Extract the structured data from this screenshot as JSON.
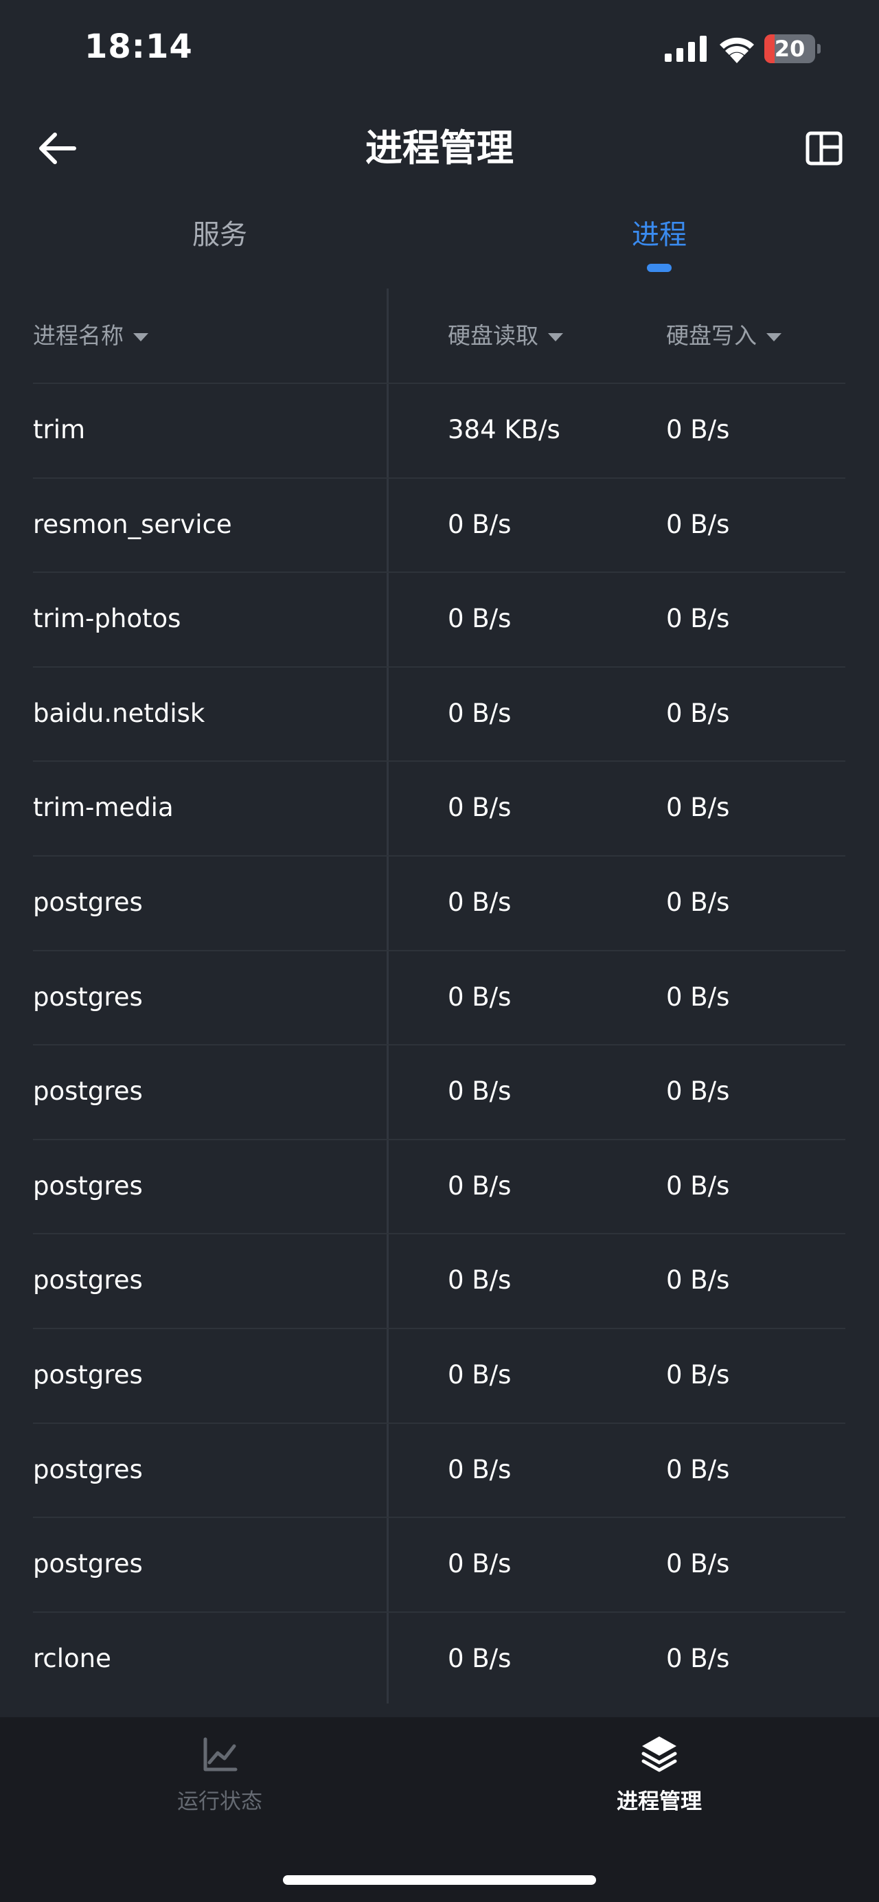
{
  "status_bar": {
    "time": "18:14",
    "battery_level": "20",
    "battery_fraction": 0.2
  },
  "header": {
    "title": "进程管理"
  },
  "tabs": [
    {
      "label": "服务",
      "active": false
    },
    {
      "label": "进程",
      "active": true
    }
  ],
  "table": {
    "columns": [
      {
        "label": "进程名称"
      },
      {
        "label": "硬盘读取"
      },
      {
        "label": "硬盘写入"
      }
    ],
    "rows": [
      {
        "name": "trim",
        "read": "384 KB/s",
        "write": "0 B/s"
      },
      {
        "name": "resmon_service",
        "read": "0 B/s",
        "write": "0 B/s"
      },
      {
        "name": "trim-photos",
        "read": "0 B/s",
        "write": "0 B/s"
      },
      {
        "name": "baidu.netdisk",
        "read": "0 B/s",
        "write": "0 B/s"
      },
      {
        "name": "trim-media",
        "read": "0 B/s",
        "write": "0 B/s"
      },
      {
        "name": "postgres",
        "read": "0 B/s",
        "write": "0 B/s"
      },
      {
        "name": "postgres",
        "read": "0 B/s",
        "write": "0 B/s"
      },
      {
        "name": "postgres",
        "read": "0 B/s",
        "write": "0 B/s"
      },
      {
        "name": "postgres",
        "read": "0 B/s",
        "write": "0 B/s"
      },
      {
        "name": "postgres",
        "read": "0 B/s",
        "write": "0 B/s"
      },
      {
        "name": "postgres",
        "read": "0 B/s",
        "write": "0 B/s"
      },
      {
        "name": "postgres",
        "read": "0 B/s",
        "write": "0 B/s"
      },
      {
        "name": "postgres",
        "read": "0 B/s",
        "write": "0 B/s"
      },
      {
        "name": "rclone",
        "read": "0 B/s",
        "write": "0 B/s"
      }
    ]
  },
  "bottom_nav": [
    {
      "label": "运行状态",
      "icon": "line-chart-icon",
      "active": false
    },
    {
      "label": "进程管理",
      "icon": "layers-icon",
      "active": true
    }
  ],
  "colors": {
    "background": "#22262d",
    "accent": "#3a8bf0",
    "nav_background": "#191b20",
    "battery_low": "#e9463f"
  }
}
